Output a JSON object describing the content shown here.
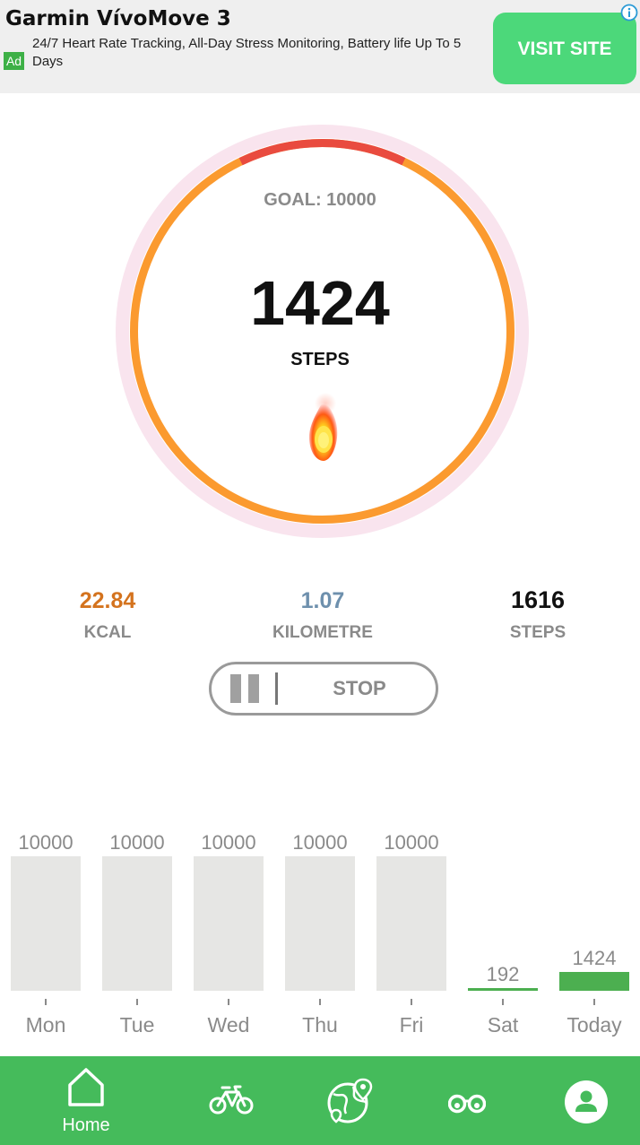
{
  "ad": {
    "title": "Garmin VívoMove 3",
    "badge": "Ad",
    "description": "24/7 Heart Rate Tracking, All-Day Stress Monitoring, Battery life Up To 5 Days",
    "cta": "VISIT SITE",
    "icons": [
      "info-icon"
    ]
  },
  "progress": {
    "goal_label": "GOAL: 10000",
    "steps": "1424",
    "steps_label": "STEPS",
    "fraction": 0.1424
  },
  "stats": [
    {
      "value": "22.84",
      "label": "KCAL"
    },
    {
      "value": "1.07",
      "label": "KILOMETRE"
    },
    {
      "value": "1616",
      "label": "STEPS"
    }
  ],
  "controls": {
    "stop_label": "STOP",
    "icons": [
      "pause-icon"
    ]
  },
  "chart_data": {
    "type": "bar",
    "categories": [
      "Mon",
      "Tue",
      "Wed",
      "Thu",
      "Fri",
      "Sat",
      "Today"
    ],
    "values": [
      10000,
      10000,
      10000,
      10000,
      10000,
      192,
      1424
    ],
    "ylim": [
      0,
      10000
    ],
    "grid": false,
    "colors": {
      "goal_met": "#e6e6e4",
      "in_progress": "#4caf50"
    }
  },
  "nav": {
    "items": [
      {
        "label": "Home",
        "icon": "home-icon"
      },
      {
        "label": "",
        "icon": "bicycle-icon"
      },
      {
        "label": "",
        "icon": "map-icon"
      },
      {
        "label": "",
        "icon": "binoculars-icon"
      },
      {
        "label": "",
        "icon": "profile-icon"
      }
    ]
  },
  "colors": {
    "accent_green": "#45bb5b",
    "ring_orange": "#fb9a2f",
    "ring_red": "#e94b3f",
    "ring_halo": "#f9e4ee",
    "kcal": "#d4731e",
    "distance": "#6e90ad"
  }
}
